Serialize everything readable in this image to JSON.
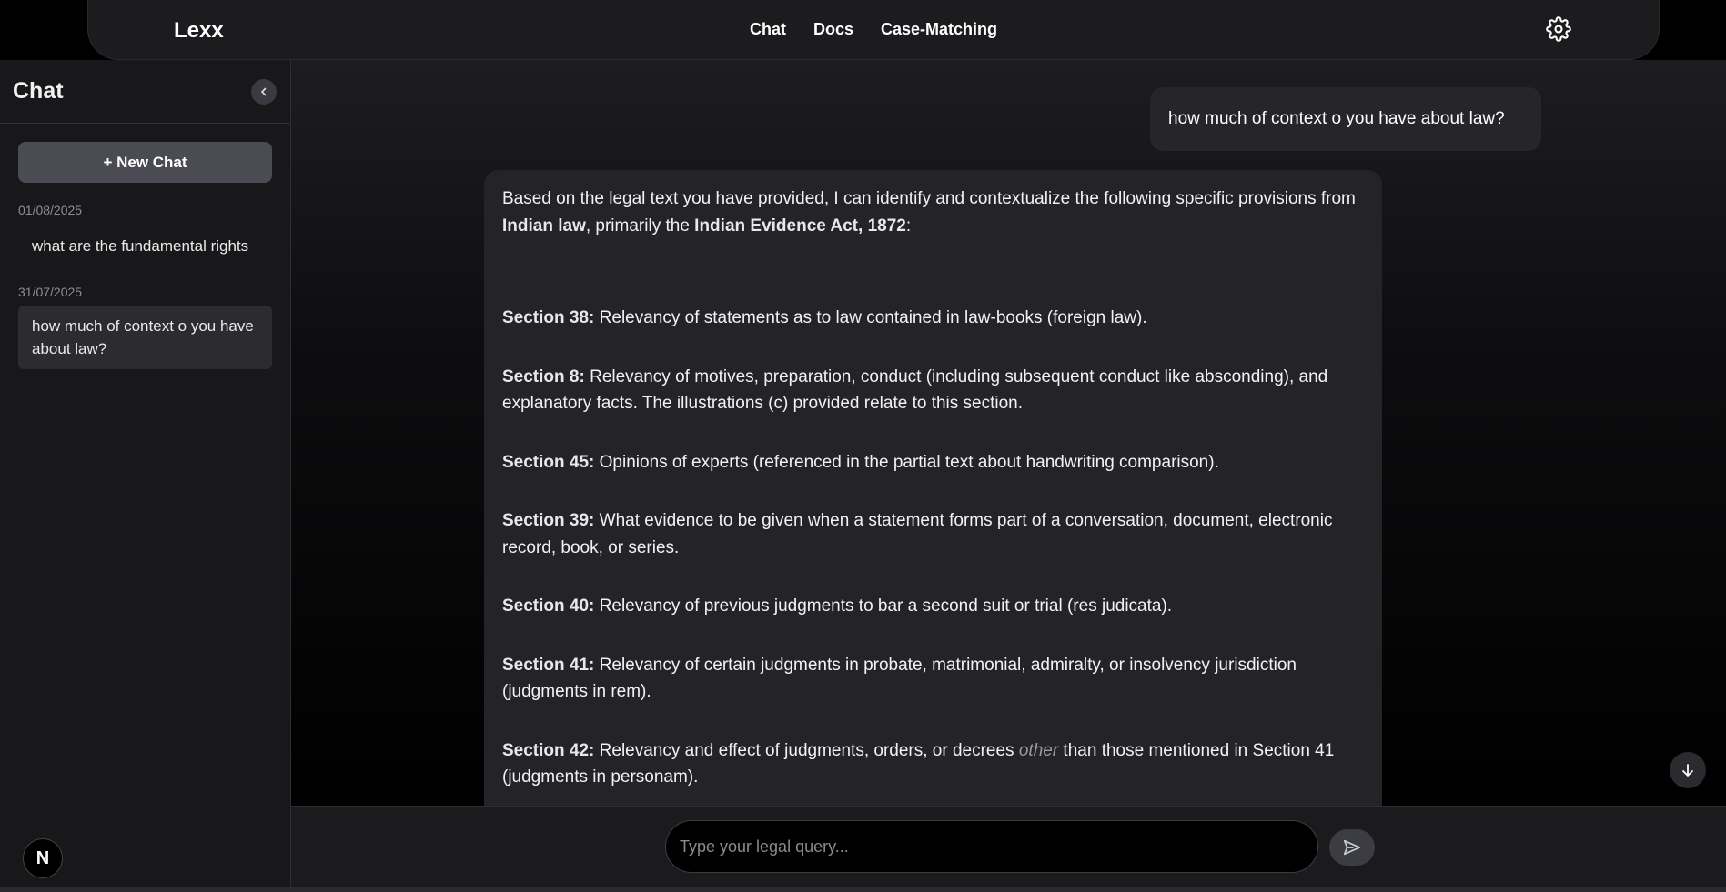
{
  "app": {
    "name": "Lexx"
  },
  "nav": {
    "items": [
      "Chat",
      "Docs",
      "Case-Matching"
    ]
  },
  "icons": {
    "settings": "gear-icon",
    "collapse": "chevron-left-icon",
    "scroll": "arrow-down-icon",
    "send": "send-icon"
  },
  "sidebar": {
    "title": "Chat",
    "new_chat_label": "+ New Chat",
    "groups": [
      {
        "date": "01/08/2025",
        "items": [
          "what are the fundamental rights"
        ]
      },
      {
        "date": "31/07/2025",
        "items": [
          "how much of context o you have about law?"
        ]
      }
    ],
    "badge": "N"
  },
  "conversation": {
    "user_message": "how much of context o you have about law?",
    "bot": {
      "intro_1": "Based on the legal text you have provided, I can identify and contextualize the following specific provisions from ",
      "intro_b1": "Indian law",
      "intro_2": ", primarily the ",
      "intro_b2": "Indian Evidence Act, 1872",
      "intro_3": ":",
      "sections": [
        {
          "label": "Section 38:",
          "text": " Relevancy of statements as to law contained in law-books (foreign law)."
        },
        {
          "label": "Section 8:",
          "text": " Relevancy of motives, preparation, conduct (including subsequent conduct like absconding), and explanatory facts. The illustrations (c) provided relate to this section."
        },
        {
          "label": "Section 45:",
          "text": " Opinions of experts (referenced in the partial text about handwriting comparison)."
        },
        {
          "label": "Section 39:",
          "text": " What evidence to be given when a statement forms part of a conversation, document, electronic record, book, or series."
        },
        {
          "label": "Section 40:",
          "text": " Relevancy of previous judgments to bar a second suit or trial (res judicata)."
        },
        {
          "label": "Section 41:",
          "text": " Relevancy of certain judgments in probate, matrimonial, admiralty, or insolvency jurisdiction (judgments in rem)."
        }
      ],
      "last": {
        "label": "Section 42:",
        "pre": " Relevancy and effect of judgments, orders, or decrees ",
        "em": "other",
        "post": " than those mentioned in Section 41 (judgments in personam)."
      }
    }
  },
  "input": {
    "placeholder": "Type your legal query..."
  }
}
